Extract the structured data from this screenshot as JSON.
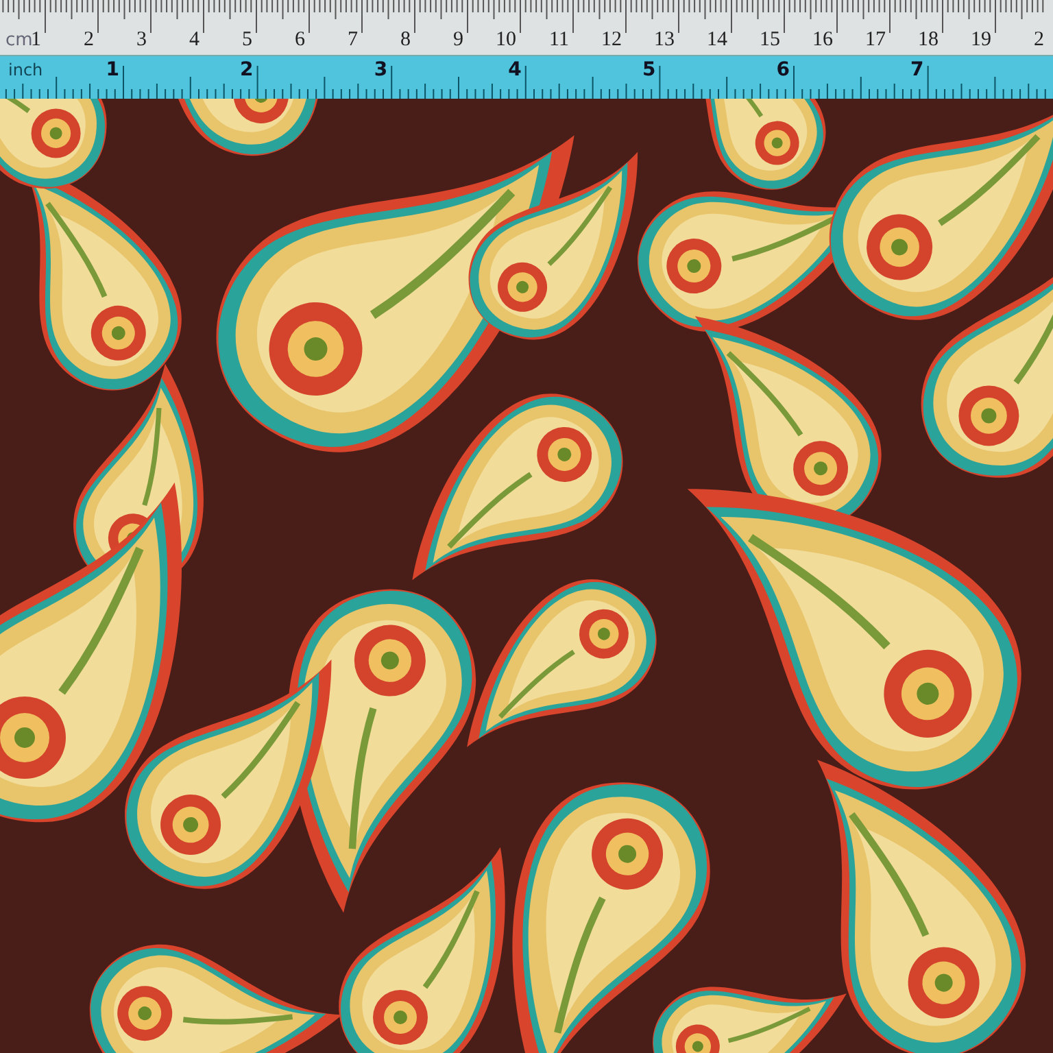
{
  "ruler": {
    "cm_unit": "cm",
    "cm_labels": [
      "1",
      "2",
      "3",
      "4",
      "5",
      "6",
      "7",
      "8",
      "9",
      "10",
      "11",
      "12",
      "13",
      "14",
      "15",
      "16",
      "17",
      "18",
      "19",
      "2"
    ],
    "inch_unit": "inch",
    "inch_labels": [
      "1",
      "2",
      "3",
      "4",
      "5",
      "6",
      "7"
    ]
  }
}
